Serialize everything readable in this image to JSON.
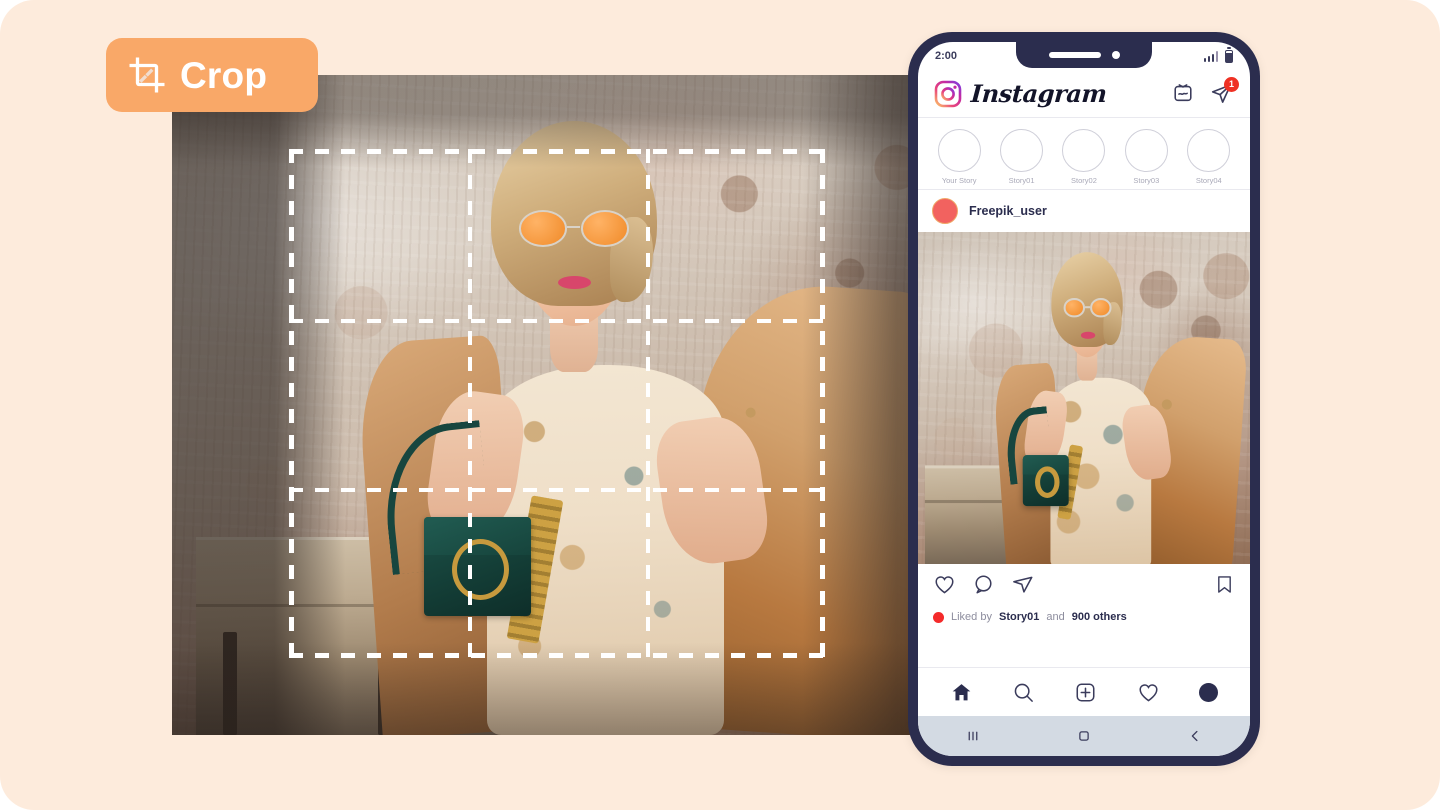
{
  "canvas": {
    "background_color": "#FDEBDC"
  },
  "crop_badge": {
    "label": "Crop",
    "icon": "crop-icon",
    "background_color": "#F9A868",
    "text_color": "#FFFFFF"
  },
  "editor": {
    "name": "crop-editor-canvas",
    "crop_overlay": {
      "grid": "rule-of-thirds",
      "rows": 3,
      "columns": 3,
      "line_style": "dashed",
      "line_color": "#FFFFFF"
    },
    "photo_alt": "Blonde woman in orange round sunglasses, floral dress, tan coat holding dark green handbag against textured plaster wall"
  },
  "phone": {
    "frame_color": "#2B2D4E",
    "status_bar": {
      "time": "2:00",
      "signal_icon": "signal-bars-icon",
      "battery_icon": "battery-icon"
    },
    "app_header": {
      "logo_icon": "instagram-camera-icon",
      "wordmark": "Instagram",
      "igtv_icon": "igtv-icon",
      "messages_icon": "paper-plane-icon",
      "messages_badge": "1",
      "badge_color": "#EF3124"
    },
    "stories": [
      {
        "name": "Your Story",
        "color": "#2B2D4E"
      },
      {
        "name": "Story01",
        "color": "#F42A2A"
      },
      {
        "name": "Story02",
        "color": "#6EC6F0"
      },
      {
        "name": "Story03",
        "color": "#F4C430"
      },
      {
        "name": "Story04",
        "color": "#FA6400"
      }
    ],
    "post": {
      "username": "Freepik_user",
      "avatar_color": "#F2625F",
      "actions": {
        "like_icon": "heart-icon",
        "comment_icon": "comment-bubble-icon",
        "share_icon": "paper-plane-icon",
        "save_icon": "bookmark-icon"
      },
      "likes": {
        "prefix": "Liked by",
        "user": "Story01",
        "middle": "and",
        "others": "900 others",
        "dot_color": "#F42A2A"
      }
    },
    "bottom_nav": [
      {
        "name": "home",
        "icon": "home-icon"
      },
      {
        "name": "search",
        "icon": "search-icon"
      },
      {
        "name": "add",
        "icon": "plus-square-icon"
      },
      {
        "name": "activity",
        "icon": "heart-icon"
      },
      {
        "name": "profile",
        "icon": "profile-avatar-icon"
      }
    ],
    "android_nav": [
      {
        "name": "recents",
        "icon": "recents-icon"
      },
      {
        "name": "home",
        "icon": "home-square-icon"
      },
      {
        "name": "back",
        "icon": "back-chevron-icon"
      }
    ]
  }
}
